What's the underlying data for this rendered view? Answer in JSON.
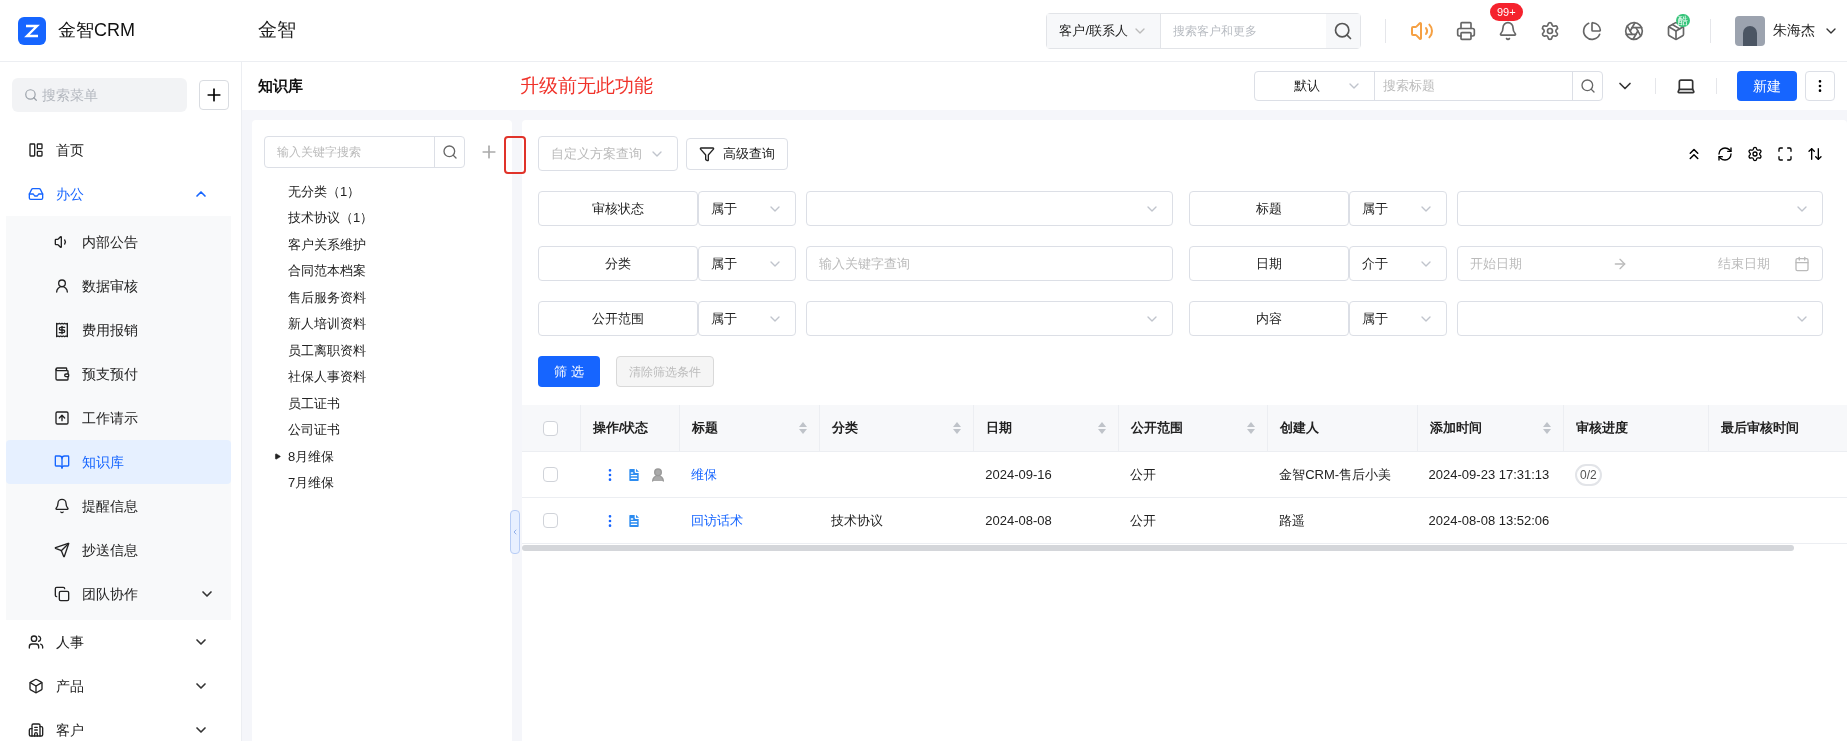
{
  "header": {
    "logo_text": "金智CRM",
    "org_name": "金智",
    "search": {
      "scope": "客户/联系人",
      "placeholder": "搜索客户和更多"
    },
    "notification_badge": "99+",
    "app_badge": "酷",
    "user_name": "朱海杰"
  },
  "sidebar": {
    "search_placeholder": "搜索菜单",
    "items": [
      {
        "label": "首页",
        "selected": false
      },
      {
        "label": "办公",
        "selected": false,
        "expanded": true,
        "children": [
          {
            "label": "内部公告",
            "selected": false
          },
          {
            "label": "数据审核",
            "selected": false
          },
          {
            "label": "费用报销",
            "selected": false
          },
          {
            "label": "预支预付",
            "selected": false
          },
          {
            "label": "工作请示",
            "selected": false
          },
          {
            "label": "知识库",
            "selected": true
          },
          {
            "label": "提醒信息",
            "selected": false
          },
          {
            "label": "抄送信息",
            "selected": false
          },
          {
            "label": "团队协作",
            "selected": false,
            "expanded": false
          }
        ]
      },
      {
        "label": "人事",
        "selected": false,
        "expanded": false
      },
      {
        "label": "产品",
        "selected": false,
        "expanded": false
      },
      {
        "label": "客户",
        "selected": false,
        "expanded": false
      }
    ]
  },
  "page": {
    "title": "知识库",
    "annotation": "升级前无此功能",
    "view_select": "默认",
    "search_placeholder": "搜索标题",
    "new_button": "新建"
  },
  "tree": {
    "search_placeholder": "输入关键字搜索",
    "items": [
      {
        "label": "无分类（1）"
      },
      {
        "label": "技术协议（1）"
      },
      {
        "label": "客户关系维护"
      },
      {
        "label": "合同范本档案"
      },
      {
        "label": "售后服务资料"
      },
      {
        "label": "新人培训资料"
      },
      {
        "label": "员工离职资料"
      },
      {
        "label": "社保人事资料"
      },
      {
        "label": "员工证书"
      },
      {
        "label": "公司证书"
      },
      {
        "label": "8月维保",
        "expanded": false
      },
      {
        "label": "7月维保"
      }
    ]
  },
  "toolbar": {
    "scheme_placeholder": "自定义方案查询",
    "advanced_button": "高级查询"
  },
  "filters": [
    {
      "kind": "select",
      "label": "审核状态",
      "operator": "属于"
    },
    {
      "kind": "select",
      "label": "标题",
      "operator": "属于"
    },
    {
      "kind": "text",
      "label": "分类",
      "operator": "属于",
      "placeholder": "输入关键字查询"
    },
    {
      "kind": "date_range",
      "label": "日期",
      "operator": "介于",
      "start_placeholder": "开始日期",
      "end_placeholder": "结束日期"
    },
    {
      "kind": "select",
      "label": "公开范围",
      "operator": "属于"
    },
    {
      "kind": "select",
      "label": "内容",
      "operator": "属于"
    }
  ],
  "filter_buttons": {
    "apply": "筛 选",
    "clear": "清除筛选条件",
    "clear_disabled": true
  },
  "table": {
    "select_all_checked": false,
    "columns": [
      {
        "label": "操作/状态",
        "sortable": false
      },
      {
        "label": "标题",
        "sortable": true
      },
      {
        "label": "分类",
        "sortable": true
      },
      {
        "label": "日期",
        "sortable": true
      },
      {
        "label": "公开范围",
        "sortable": true
      },
      {
        "label": "创建人",
        "sortable": false
      },
      {
        "label": "添加时间",
        "sortable": true
      },
      {
        "label": "审核进度",
        "sortable": false
      },
      {
        "label": "最后审核时间",
        "sortable": false
      }
    ],
    "rows": [
      {
        "checked": false,
        "has_assignee": true,
        "title": "维保",
        "date": "2024-09-16",
        "scope": "公开",
        "creator": "金智CRM-售后小美",
        "added": "2024-09-23 17:31:13",
        "progress": "0/2"
      },
      {
        "checked": false,
        "has_assignee": false,
        "title": "回访话术",
        "category": "技术协议",
        "date": "2024-08-08",
        "scope": "公开",
        "creator": "路遥",
        "added": "2024-08-08 13:52:06"
      }
    ]
  }
}
